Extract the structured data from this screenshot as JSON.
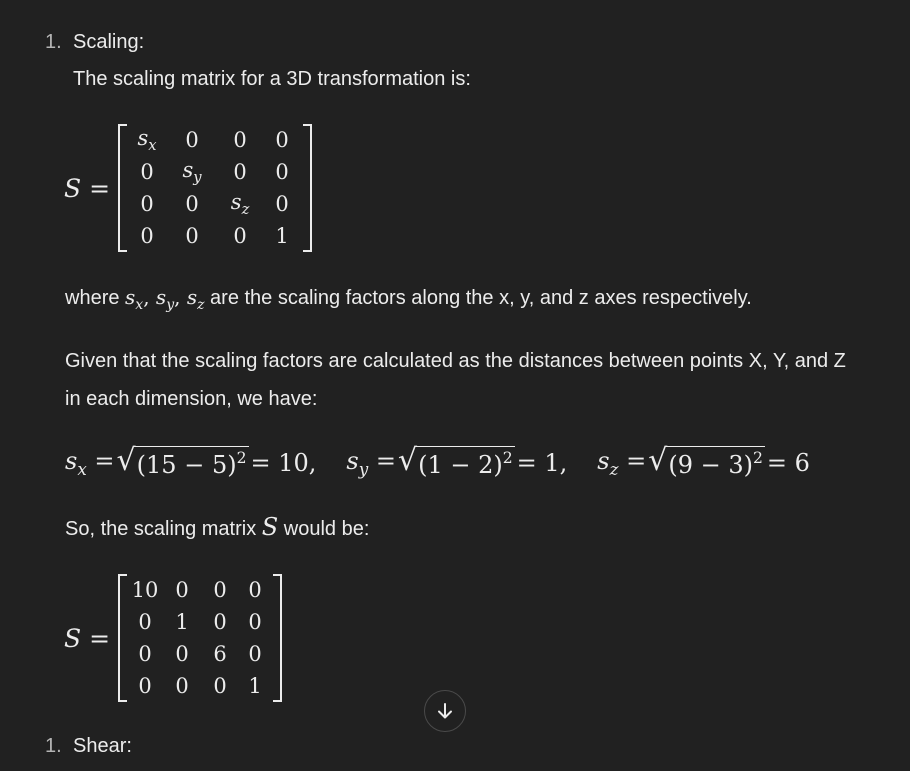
{
  "section1": {
    "number": "1.",
    "title": "Scaling:",
    "intro": "The scaling matrix for a 3D transformation is:"
  },
  "matrix_general": {
    "lhs": "S =",
    "rows": [
      [
        "s_x",
        "0",
        "0",
        "0"
      ],
      [
        "0",
        "s_y",
        "0",
        "0"
      ],
      [
        "0",
        "0",
        "s_z",
        "0"
      ],
      [
        "0",
        "0",
        "0",
        "1"
      ]
    ]
  },
  "where_text": {
    "prefix": "where ",
    "suffix": " are the scaling factors along the x, y, and z axes respectively."
  },
  "given_text": {
    "line1": "Given that the scaling factors are calculated as the distances between points X, Y, and Z",
    "line2": "in each dimension, we have:"
  },
  "formula": {
    "sx_expr": "(15 − 5)",
    "sx_result": "= 10,",
    "sy_expr": "(1 − 2)",
    "sy_result": "= 1,",
    "sz_expr": "(9 − 3)",
    "sz_result": "= 6"
  },
  "so_text": {
    "prefix": "So, the scaling matrix ",
    "var": "S",
    "suffix": " would be:"
  },
  "matrix_values": {
    "lhs": "S =",
    "rows": [
      [
        "10",
        "0",
        "0",
        "0"
      ],
      [
        "0",
        "1",
        "0",
        "0"
      ],
      [
        "0",
        "0",
        "6",
        "0"
      ],
      [
        "0",
        "0",
        "0",
        "1"
      ]
    ]
  },
  "section2": {
    "number": "1.",
    "title": "Shear:"
  },
  "scroll_button": {
    "icon": "arrow-down-icon"
  }
}
